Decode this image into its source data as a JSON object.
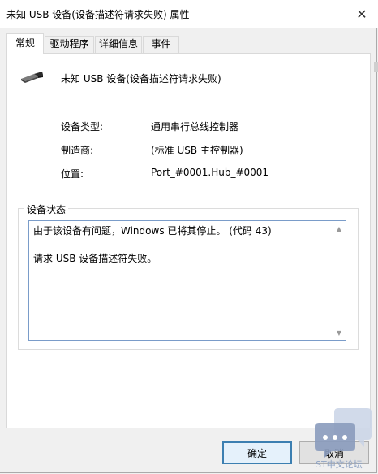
{
  "window": {
    "title": "未知 USB 设备(设备描述符请求失败) 属性",
    "close_glyph": "✕"
  },
  "tabs": [
    {
      "label": "常规",
      "active": true
    },
    {
      "label": "驱动程序",
      "active": false
    },
    {
      "label": "详细信息",
      "active": false
    },
    {
      "label": "事件",
      "active": false
    }
  ],
  "device": {
    "icon": "usb-connector-icon",
    "name": "未知 USB 设备(设备描述符请求失败)"
  },
  "properties": [
    {
      "label": "设备类型:",
      "value": "通用串行总线控制器"
    },
    {
      "label": "制造商:",
      "value": "(标准 USB 主控制器)"
    },
    {
      "label": "位置:",
      "value": "Port_#0001.Hub_#0001"
    }
  ],
  "status": {
    "legend": "设备状态",
    "line1": "由于该设备有问题，Windows 已将其停止。 (代码 43)",
    "line2": "请求 USB 设备描述符失败。",
    "scroll_up": "▲",
    "scroll_down": "▼"
  },
  "buttons": {
    "ok": "确定",
    "cancel": "取消"
  },
  "watermark": {
    "text": "ST中文论坛",
    "icon": "chat-bubble-icon"
  },
  "colors": {
    "accent": "#3c7fb1",
    "status_border": "#7a9cc9",
    "watermark": "#8fa3c3"
  }
}
